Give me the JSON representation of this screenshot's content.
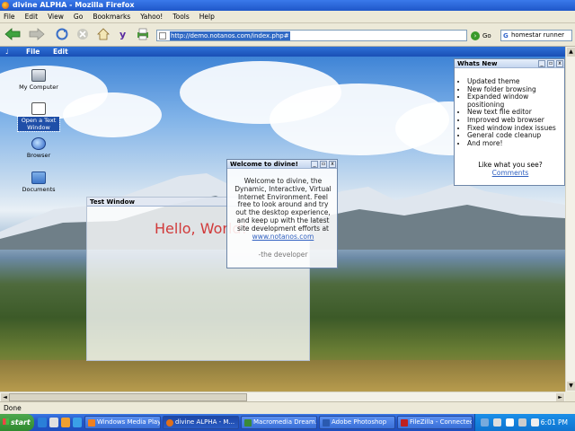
{
  "window": {
    "title": "divine ALPHA - Mozilla Firefox"
  },
  "menu": [
    "File",
    "Edit",
    "View",
    "Go",
    "Bookmarks",
    "Yahoo!",
    "Tools",
    "Help"
  ],
  "address": {
    "url": "http://demo.notanos.com/index.php#"
  },
  "go_label": "Go",
  "search": {
    "value": "homestar runner"
  },
  "app_menu": {
    "logo": "♩",
    "file": "File",
    "edit": "Edit"
  },
  "desktop_icons": [
    {
      "label": "My Computer",
      "icon": "computer-icon"
    },
    {
      "label": "Open a Text Window",
      "icon": "text-window-icon"
    },
    {
      "label": "Browser",
      "icon": "globe-icon"
    },
    {
      "label": "Documents",
      "icon": "folder-icon"
    }
  ],
  "test_window": {
    "title": "Test Window",
    "text": "Hello, World!"
  },
  "welcome_window": {
    "title": "Welcome to divine!",
    "lines": [
      "Welcome to divine, the",
      "Dynamic, Interactive, Virtual",
      "Internet Environment. Feel",
      "free to look around and try",
      "out the desktop experience,",
      "and keep up with the latest",
      "site development efforts at"
    ],
    "link": "www.notanos.com",
    "signature": "-the developer"
  },
  "whats_new": {
    "title": "Whats New",
    "items": [
      "Updated theme",
      "New folder browsing",
      "Expanded window positioning",
      "New text file editor",
      "Improved web browser",
      "Fixed window index issues",
      "General code cleanup",
      "And more!"
    ],
    "question": "Like what you see?",
    "link": "Comments"
  },
  "status": "Done",
  "taskbar": {
    "start": "start",
    "tasks": [
      "Windows Media Player",
      "divine ALPHA - M...",
      "Macromedia Dream...",
      "Adobe Photoshop",
      "FileZilla - Connected..."
    ],
    "clock": "6:01 PM"
  },
  "colors": {
    "accent": "#316ac5",
    "hello": "#d13a3a",
    "link": "#3060c0"
  }
}
